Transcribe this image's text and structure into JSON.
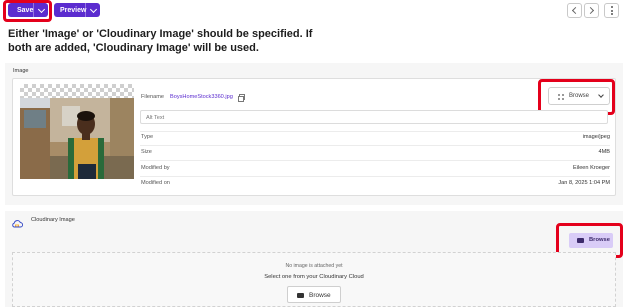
{
  "toolbar": {
    "save_label": "Save",
    "preview_label": "Preview"
  },
  "notice": {
    "line1": "Either 'Image' or 'Cloudinary Image' should be specified. If",
    "line2": "both are added, 'Cloudinary Image' will be used."
  },
  "image_field": {
    "label": "Image",
    "filename_label": "Filename",
    "filename": "BoysHomeStock3360.jpg",
    "browse_label": "Browse",
    "alt_placeholder": "Alt Text",
    "meta": [
      {
        "key": "Type",
        "value": "image/jpeg"
      },
      {
        "key": "Size",
        "value": "4MB"
      },
      {
        "key": "Modified by",
        "value": "Eileen Kroeger"
      },
      {
        "key": "Modified on",
        "value": "Jan 8, 2025 1:04 PM"
      }
    ]
  },
  "cloudinary": {
    "label": "Cloudinary Image",
    "browse_label": "Browse",
    "empty_text": "No image is attached yet",
    "select_text": "Select one from your Cloudinary Cloud",
    "browse2_label": "Browse"
  },
  "colors": {
    "accent": "#5b2ccf",
    "highlight": "#e4001b",
    "browse_light": "#d9ccf7"
  }
}
